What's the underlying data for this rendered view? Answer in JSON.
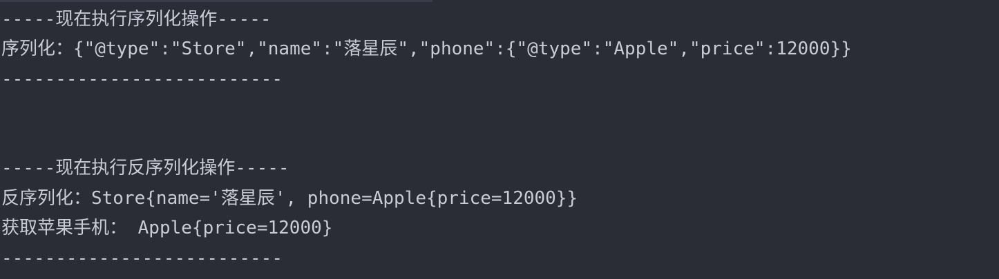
{
  "console": {
    "lines": [
      "-----现在执行序列化操作-----",
      "序列化：{\"@type\":\"Store\",\"name\":\"落星辰\",\"phone\":{\"@type\":\"Apple\",\"price\":12000}}",
      "--------------------------",
      "-----现在执行反序列化操作-----",
      "反序列化：Store{name='落星辰', phone=Apple{price=12000}}",
      "获取苹果手机： Apple{price=12000}",
      "--------------------------"
    ]
  }
}
